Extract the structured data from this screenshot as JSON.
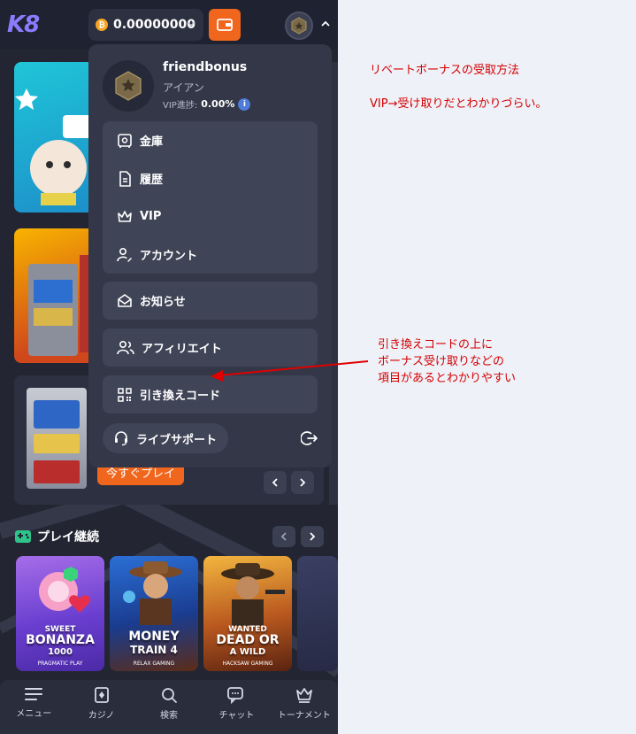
{
  "header": {
    "logo": "K8",
    "balance": "0.00000000",
    "coin_symbol": "₿"
  },
  "profile": {
    "username": "friendbonus",
    "rank": "アイアン",
    "vip_label": "VIP進捗:",
    "vip_value": "0.00%",
    "info_symbol": "i"
  },
  "menu": {
    "items": [
      {
        "label": "金庫",
        "icon": "vault-icon"
      },
      {
        "label": "履歴",
        "icon": "document-icon"
      },
      {
        "label": "VIP",
        "icon": "crown-icon"
      },
      {
        "label": "アカウント",
        "icon": "user-edit-icon"
      },
      {
        "label": "お知らせ",
        "icon": "envelope-icon"
      },
      {
        "label": "アフィリエイト",
        "icon": "users-icon"
      },
      {
        "label": "引き換えコード",
        "icon": "qr-code-icon"
      }
    ],
    "live_support": "ライブサポート"
  },
  "main": {
    "play_now": "今すぐプレイ",
    "section_title": "プレイ継続",
    "games": [
      {
        "title_line1": "SWEET",
        "title_line2": "BONANZA",
        "title_line3": "1000",
        "provider": "PRAGMATIC PLAY"
      },
      {
        "title_line1": "MONEY",
        "title_line2": "TRAIN 4",
        "title_line3": "",
        "provider": "RELAX GAMING"
      },
      {
        "title_line1": "WANTED",
        "title_line2": "DEAD OR",
        "title_line3": "A WILD",
        "provider": "HACKSAW GAMING"
      }
    ]
  },
  "bottom_nav": [
    {
      "label": "メニュー",
      "icon": "menu-icon"
    },
    {
      "label": "カジノ",
      "icon": "casino-icon"
    },
    {
      "label": "検索",
      "icon": "search-icon"
    },
    {
      "label": "チャット",
      "icon": "chat-icon"
    },
    {
      "label": "トーナメント",
      "icon": "trophy-icon"
    }
  ],
  "annotations": {
    "note_1": "リベートボーナスの受取方法",
    "note_2": "VIP→受け取りだとわかりづらい。",
    "note_3_line1": "引き換えコードの上に",
    "note_3_line2": "ボーナス受け取りなどの",
    "note_3_line3": "項目があるとわかりやすい"
  },
  "colors": {
    "accent_orange": "#f0661d",
    "panel_bg": "#333747",
    "app_bg": "#232632",
    "annotation_red": "#d40000"
  }
}
